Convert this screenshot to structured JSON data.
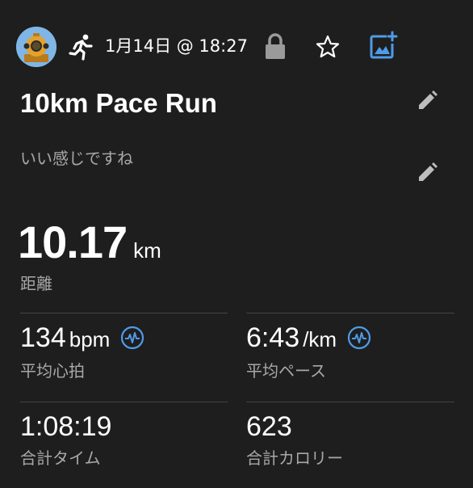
{
  "header": {
    "datetime": "1月14日 @ 18:27",
    "icons": [
      "avatar",
      "running-icon",
      "lock-icon",
      "star-icon",
      "add-photo-icon"
    ]
  },
  "activity": {
    "title": "10km Pace Run",
    "note": "いい感じですね"
  },
  "distance": {
    "value": "10.17",
    "unit": "km",
    "label": "距離"
  },
  "stats": {
    "avg_hr": {
      "value": "134",
      "unit": "bpm",
      "label": "平均心拍"
    },
    "avg_pace": {
      "value": "6:43",
      "unit": "/km",
      "label": "平均ペース"
    },
    "total_time": {
      "value": "1:08:19",
      "label": "合計タイム"
    },
    "total_calories": {
      "value": "623",
      "label": "合計カロリー"
    }
  },
  "colors": {
    "background": "#1e1e1e",
    "text": "#ffffff",
    "secondary_text": "#a8a8a8",
    "accent": "#4f9be8",
    "divider": "#444444"
  }
}
